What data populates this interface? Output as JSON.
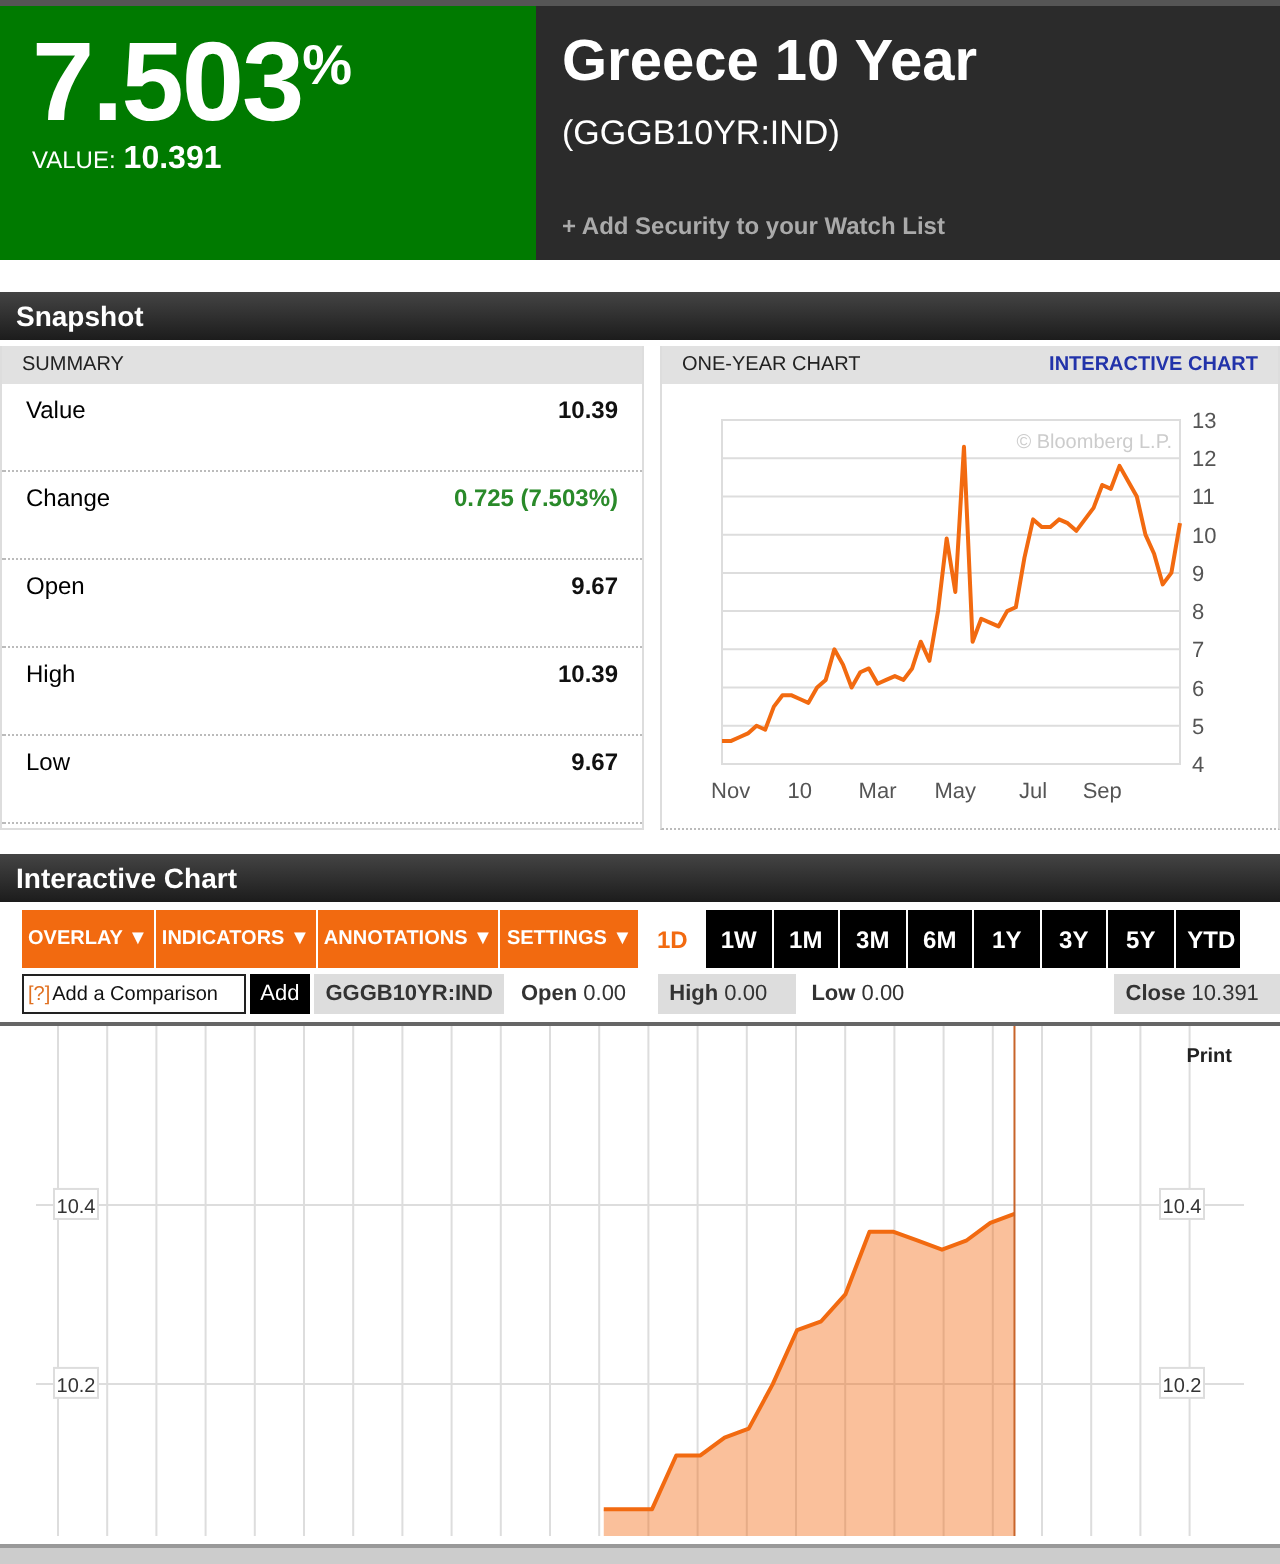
{
  "quote": {
    "change_percent": "7.503",
    "percent_sign": "%",
    "value_label": "VALUE:",
    "value": "10.391",
    "title": "Greece 10 Year",
    "ticker": "(GGGB10YR:IND)",
    "watch_link": "+ Add Security to your Watch List"
  },
  "snapshot": {
    "title": "Snapshot",
    "summary": {
      "heading": "SUMMARY",
      "rows": [
        {
          "label": "Value",
          "value": "10.39",
          "color": "#111111"
        },
        {
          "label": "Change",
          "value": "0.725 (7.503%)",
          "color": "#2a8a2a"
        },
        {
          "label": "Open",
          "value": "9.67",
          "color": "#111111"
        },
        {
          "label": "High",
          "value": "10.39",
          "color": "#111111"
        },
        {
          "label": "Low",
          "value": "9.67",
          "color": "#111111"
        }
      ]
    },
    "one_year": {
      "heading": "ONE-YEAR CHART",
      "link": "INTERACTIVE CHART",
      "watermark": "© Bloomberg L.P.",
      "chart_data": {
        "type": "line",
        "categories": [
          null,
          "Nov",
          null,
          null,
          null,
          null,
          null,
          null,
          null,
          "10",
          null,
          null,
          null,
          null,
          null,
          null,
          null,
          null,
          "Mar",
          null,
          null,
          null,
          null,
          null,
          null,
          null,
          null,
          "May",
          null,
          null,
          null,
          null,
          null,
          null,
          null,
          null,
          "Jul",
          null,
          null,
          null,
          null,
          null,
          null,
          null,
          "Sep",
          null,
          null,
          null,
          null,
          null,
          null,
          null,
          null,
          null
        ],
        "ylim": [
          4,
          13
        ],
        "yticks": [
          4,
          5,
          6,
          7,
          8,
          9,
          10,
          11,
          12,
          13
        ],
        "grid": true,
        "series": [
          {
            "color": "#f26a10",
            "values": [
              4.6,
              4.6,
              4.7,
              4.8,
              5.0,
              4.9,
              5.5,
              5.8,
              5.8,
              5.7,
              5.6,
              6.0,
              6.2,
              7.0,
              6.6,
              6.0,
              6.4,
              6.5,
              6.1,
              6.2,
              6.3,
              6.2,
              6.5,
              7.2,
              6.7,
              8.0,
              9.9,
              8.5,
              12.3,
              7.2,
              7.8,
              7.7,
              7.6,
              8.0,
              8.1,
              9.4,
              10.4,
              10.2,
              10.2,
              10.4,
              10.3,
              10.1,
              10.4,
              10.7,
              11.3,
              11.2,
              11.8,
              11.4,
              11.0,
              10.0,
              9.5,
              8.7,
              9.0,
              10.3
            ]
          }
        ]
      }
    }
  },
  "interactive": {
    "title": "Interactive Chart",
    "menus": [
      {
        "label": "OVERLAY ▼"
      },
      {
        "label": "INDICATORS ▼"
      },
      {
        "label": "ANNOTATIONS ▼"
      },
      {
        "label": "SETTINGS ▼"
      }
    ],
    "ranges": [
      {
        "label": "1D",
        "selected": true
      },
      {
        "label": "1W",
        "selected": false
      },
      {
        "label": "1M",
        "selected": false
      },
      {
        "label": "3M",
        "selected": false
      },
      {
        "label": "6M",
        "selected": false
      },
      {
        "label": "1Y",
        "selected": false
      },
      {
        "label": "3Y",
        "selected": false
      },
      {
        "label": "5Y",
        "selected": false
      },
      {
        "label": "YTD",
        "selected": false
      }
    ],
    "comparison": {
      "help": "[?]",
      "placeholder": "Add a Comparison",
      "button": "Add"
    },
    "ticker": "GGGB10YR:IND",
    "stats": [
      {
        "label": "Open",
        "value": "0.00",
        "shaded": false
      },
      {
        "label": "High",
        "value": "0.00",
        "shaded": true
      },
      {
        "label": "Low",
        "value": "0.00",
        "shaded": false
      },
      {
        "label": "Close",
        "value": "10.391",
        "shaded": true
      }
    ],
    "print": "Print",
    "right_axis_labels": [
      "10.4",
      "10.2"
    ],
    "chart_data": {
      "type": "area",
      "categories": [
        null,
        null,
        null,
        null,
        null,
        null,
        null,
        null,
        null,
        null,
        null,
        null,
        null,
        null,
        null,
        null,
        null,
        null,
        null,
        null,
        null,
        null,
        null,
        null,
        null,
        null,
        null,
        null,
        null,
        null,
        null,
        null,
        null,
        null,
        null,
        null,
        null,
        null,
        null,
        null,
        null,
        null,
        null,
        null,
        null,
        null,
        null,
        null,
        null,
        null
      ],
      "ylim": [
        10.03,
        10.6
      ],
      "yticks": [
        10.2,
        10.4
      ],
      "grid": true,
      "series": [
        {
          "color": "#f26a10",
          "values": [
            null,
            null,
            null,
            null,
            null,
            null,
            null,
            null,
            null,
            null,
            null,
            null,
            null,
            null,
            null,
            null,
            null,
            null,
            null,
            null,
            null,
            null,
            null,
            10.06,
            10.06,
            10.06,
            10.12,
            10.12,
            10.14,
            10.15,
            10.2,
            10.26,
            10.27,
            10.3,
            10.37,
            10.37,
            10.36,
            10.35,
            10.36,
            10.38,
            10.39,
            null,
            null,
            null,
            null,
            null,
            null,
            null,
            null,
            null
          ]
        }
      ]
    }
  }
}
